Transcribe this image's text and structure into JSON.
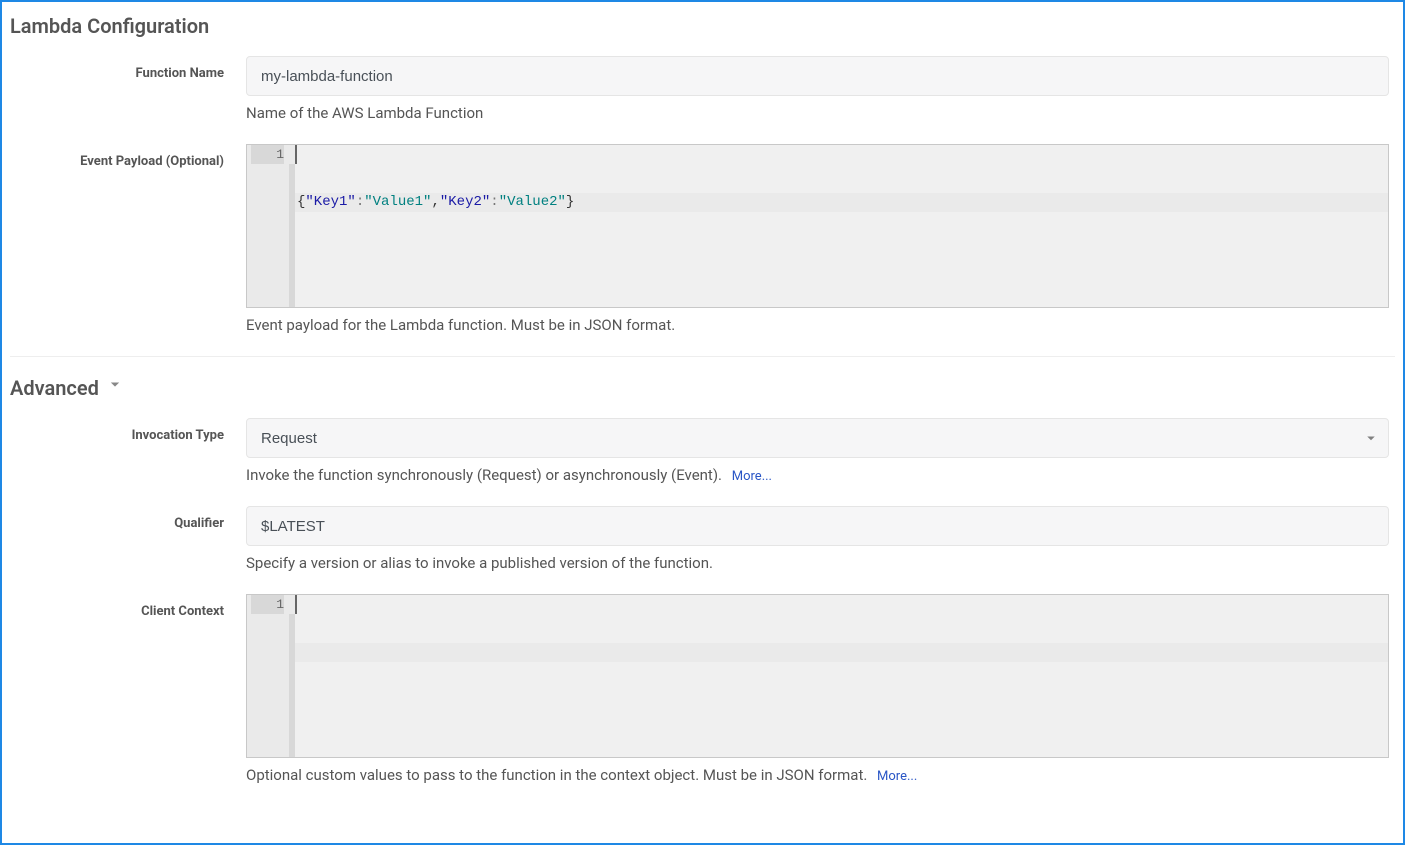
{
  "lambda": {
    "section_title": "Lambda Configuration",
    "function_name": {
      "label": "Function Name",
      "value": "my-lambda-function",
      "help": "Name of the AWS Lambda Function"
    },
    "event_payload": {
      "label": "Event Payload (Optional)",
      "line_number": "1",
      "tokens": {
        "brace_open": "{",
        "key1": "\"Key1\"",
        "colon1": ":",
        "val1": "\"Value1\"",
        "comma": ",",
        "key2": "\"Key2\"",
        "colon2": ":",
        "val2": "\"Value2\"",
        "brace_close": "}"
      },
      "help": "Event payload for the Lambda function. Must be in JSON format."
    }
  },
  "advanced": {
    "section_title": "Advanced",
    "invocation_type": {
      "label": "Invocation Type",
      "value": "Request",
      "help": "Invoke the function synchronously (Request) or asynchronously (Event).",
      "more": "More..."
    },
    "qualifier": {
      "label": "Qualifier",
      "value": "$LATEST",
      "help": "Specify a version or alias to invoke a published version of the function."
    },
    "client_context": {
      "label": "Client Context",
      "line_number": "1",
      "value": "",
      "help": "Optional custom values to pass to the function in the context object. Must be in JSON format.",
      "more": "More..."
    }
  },
  "editor_heights": {
    "payload": "164",
    "client_context": "164"
  }
}
